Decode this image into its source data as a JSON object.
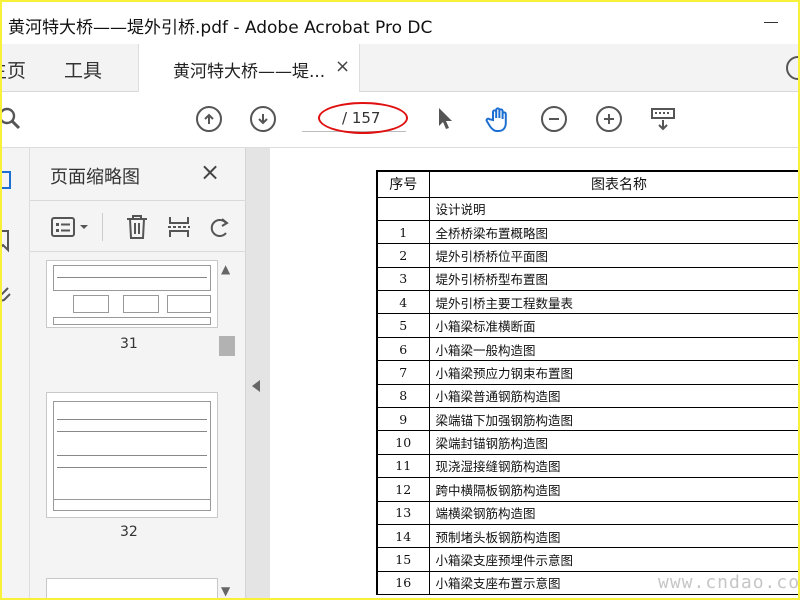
{
  "window": {
    "title": "黄河特大桥——堤外引桥.pdf - Adobe Acrobat Pro DC"
  },
  "tabs": {
    "home_label": "主页",
    "tools_label": "工具",
    "doc_tab_label": "黄河特大桥——堤...",
    "doc_tab_close": "×"
  },
  "toolbar": {
    "page_indicator": "/ 157",
    "icons": [
      "search-icon",
      "prev-page-icon",
      "next-page-icon",
      "select-cursor-icon",
      "hand-tool-icon",
      "zoom-out-icon",
      "zoom-in-icon",
      "keyboard-icon"
    ]
  },
  "thumbnails": {
    "panel_title": "页面缩略图",
    "close": "×",
    "pages": [
      "31",
      "32"
    ]
  },
  "document": {
    "header_no": "序号",
    "header_name": "图表名称",
    "rows": [
      {
        "no": "",
        "name": "设计说明"
      },
      {
        "no": "1",
        "name": "全桥桥梁布置概略图"
      },
      {
        "no": "2",
        "name": "堤外引桥桥位平面图"
      },
      {
        "no": "3",
        "name": "堤外引桥桥型布置图"
      },
      {
        "no": "4",
        "name": "堤外引桥主要工程数量表"
      },
      {
        "no": "5",
        "name": "小箱梁标准横断面"
      },
      {
        "no": "6",
        "name": "小箱梁一般构造图"
      },
      {
        "no": "7",
        "name": "小箱梁预应力钢束布置图"
      },
      {
        "no": "8",
        "name": "小箱梁普通钢筋构造图"
      },
      {
        "no": "9",
        "name": "梁端锚下加强钢筋构造图"
      },
      {
        "no": "10",
        "name": "梁端封锚钢筋构造图"
      },
      {
        "no": "11",
        "name": "现浇湿接缝钢筋构造图"
      },
      {
        "no": "12",
        "name": "跨中横隔板钢筋构造图"
      },
      {
        "no": "13",
        "name": "端横梁钢筋构造图"
      },
      {
        "no": "14",
        "name": "预制堵头板钢筋构造图"
      },
      {
        "no": "15",
        "name": "小箱梁支座预埋件示意图"
      },
      {
        "no": "16",
        "name": "小箱梁支座布置示意图"
      }
    ]
  },
  "watermark": "www.cndao.com",
  "colors": {
    "highlight_ring": "#e01010",
    "border_frame": "#f9f03a"
  }
}
